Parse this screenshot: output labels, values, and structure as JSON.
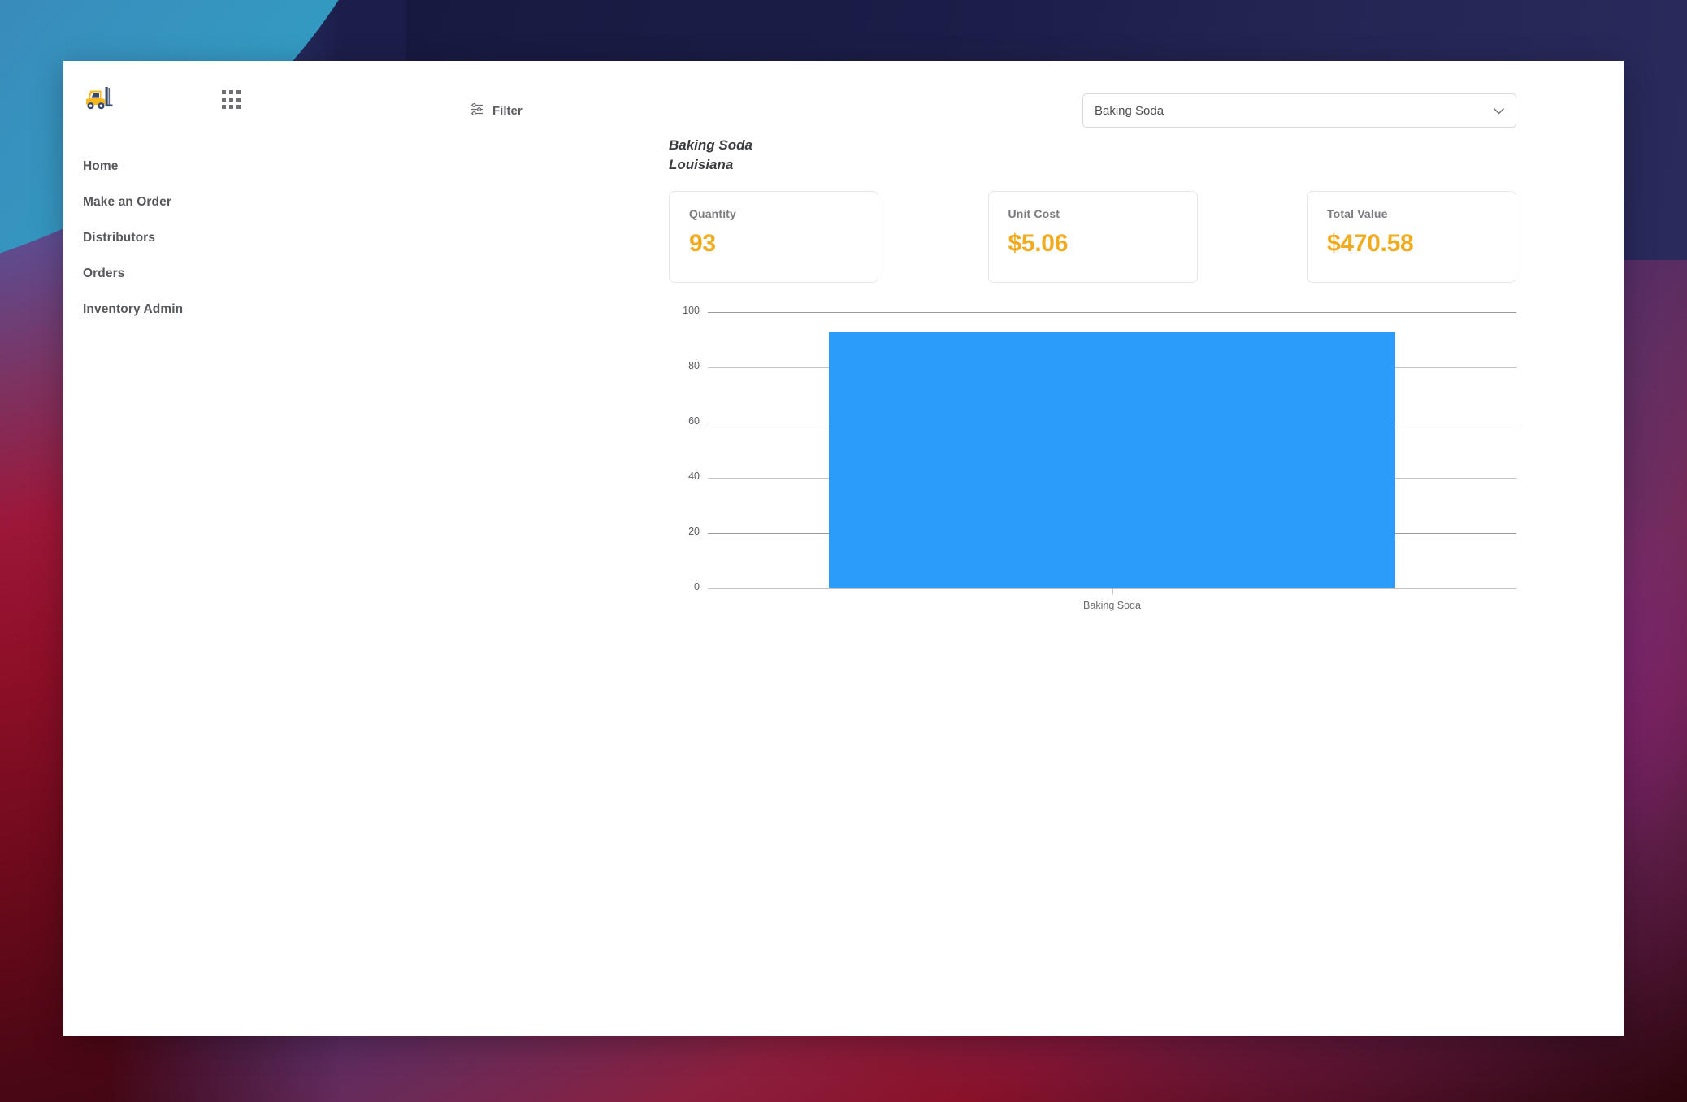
{
  "sidebar": {
    "logo_icon": "forklift-icon",
    "apps_icon": "apps-grid-icon",
    "items": [
      {
        "label": "Home"
      },
      {
        "label": "Make an Order"
      },
      {
        "label": "Distributors"
      },
      {
        "label": "Orders"
      },
      {
        "label": "Inventory Admin"
      }
    ]
  },
  "toolbar": {
    "filter_label": "Filter",
    "filter_icon": "tune-sliders-icon",
    "chevron_icon": "chevron-down-icon",
    "select": {
      "value": "Baking Soda",
      "options": [
        "Baking Soda"
      ]
    }
  },
  "header": {
    "product": "Baking Soda",
    "location": "Louisiana"
  },
  "metrics": [
    {
      "label": "Quantity",
      "value": "93"
    },
    {
      "label": "Unit Cost",
      "value": "$5.06"
    },
    {
      "label": "Total Value",
      "value": "$470.58"
    }
  ],
  "colors": {
    "accent_value": "#f2ab1f",
    "bar": "#2b9cf9",
    "gridline": "#9a9a9a",
    "sidebar_text": "#57585c"
  },
  "chart_data": {
    "type": "bar",
    "title": "",
    "xlabel": "",
    "ylabel": "",
    "categories": [
      "Baking Soda"
    ],
    "values": [
      93
    ],
    "ylim": [
      0,
      100
    ],
    "yticks": [
      0,
      20,
      40,
      60,
      80,
      100
    ],
    "ytick_labels": [
      "0",
      "20",
      "40",
      "60",
      "80",
      "100"
    ],
    "grid": true,
    "legend": false,
    "series": [
      {
        "name": "Baking Soda",
        "values": [
          93
        ],
        "color": "#2b9cf9"
      }
    ]
  }
}
